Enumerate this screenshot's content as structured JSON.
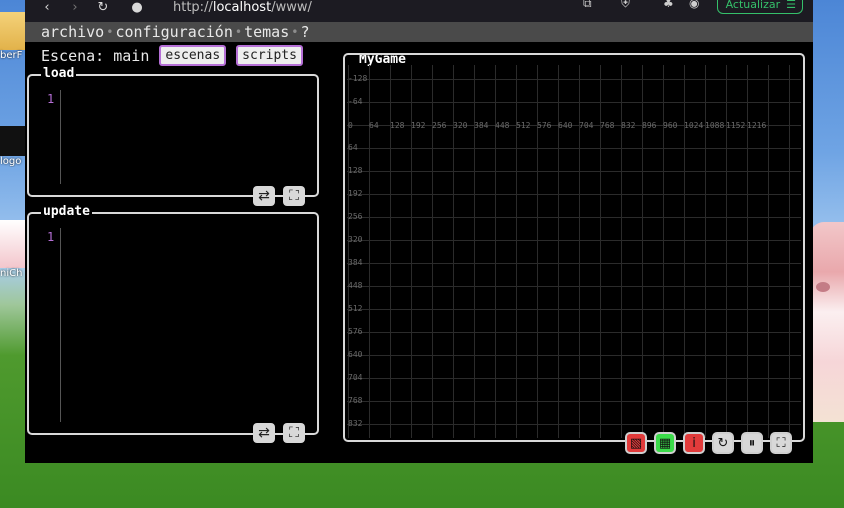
{
  "desktop": {
    "icons": [
      {
        "label": "berF"
      },
      {
        "label": "logo"
      },
      {
        "label": "niCh"
      }
    ]
  },
  "browser": {
    "url_prefix": "http://",
    "url_host": "localhost",
    "url_path": "/www/",
    "update_label": "Actualizar"
  },
  "menu": {
    "items": [
      "archivo",
      "configuración",
      "temas",
      "?"
    ]
  },
  "scene": {
    "label": "Escena: main",
    "scenes_button": "escenas",
    "scripts_button": "scripts"
  },
  "editors": [
    {
      "title": "load",
      "line_number": "1"
    },
    {
      "title": "update",
      "line_number": "1"
    }
  ],
  "game": {
    "title": "MyGame",
    "x_labels": [
      "0",
      "64",
      "128",
      "192",
      "256",
      "320",
      "384",
      "448",
      "512",
      "576",
      "640",
      "704",
      "768",
      "832",
      "896",
      "960",
      "1024",
      "1088",
      "1152",
      "1216"
    ],
    "y_labels": [
      "-128",
      "-64",
      "0",
      "64",
      "128",
      "192",
      "256",
      "320",
      "384",
      "448",
      "512",
      "576",
      "640",
      "704",
      "768",
      "832"
    ],
    "buttons": [
      {
        "icon": "hatch-icon",
        "glyph": "▧",
        "color": "#e23b3b"
      },
      {
        "icon": "grid-icon",
        "glyph": "▦",
        "color": "#3bdc4a"
      },
      {
        "icon": "info-icon",
        "glyph": "i",
        "color": "#e23b3b"
      },
      {
        "icon": "reload-icon",
        "glyph": "↻",
        "color": "#d8d8d8"
      },
      {
        "icon": "pause-icon",
        "glyph": "⏸",
        "color": "#d8d8d8"
      },
      {
        "icon": "fullscreen-icon",
        "glyph": "⛶",
        "color": "#d8d8d8"
      }
    ]
  }
}
